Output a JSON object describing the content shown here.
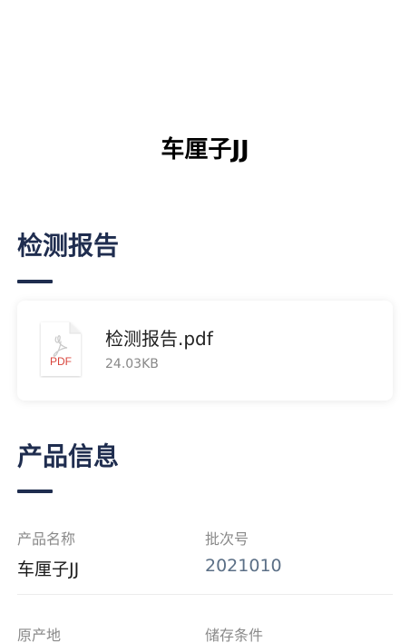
{
  "product": {
    "title": "车厘子JJ"
  },
  "report_section": {
    "heading": "检测报告",
    "file": {
      "name": "检测报告.pdf",
      "size": "24.03KB",
      "type_label": "PDF",
      "icon": "pdf-file-icon"
    }
  },
  "info_section": {
    "heading": "产品信息",
    "fields": [
      {
        "label": "产品名称",
        "value": "车厘子JJ"
      },
      {
        "label": "批次号",
        "value": "2021010"
      },
      {
        "label": "原产地",
        "value": ""
      },
      {
        "label": "储存条件",
        "value": ""
      }
    ]
  },
  "colors": {
    "heading": "#1f2d4f",
    "accent_value": "#5b6f86",
    "pdf_red": "#d9453c"
  }
}
